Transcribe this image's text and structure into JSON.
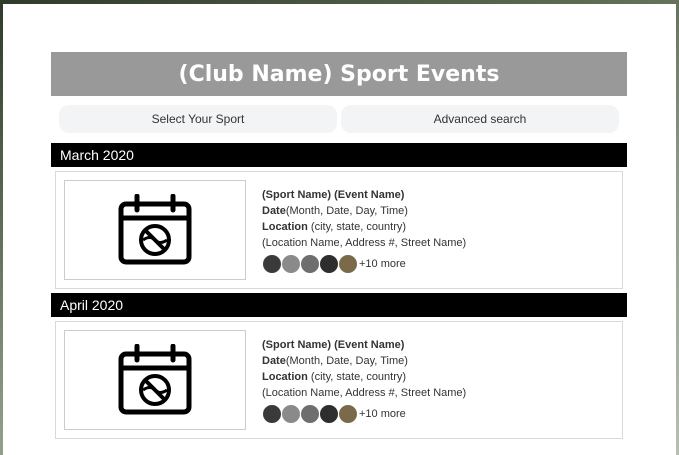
{
  "header": {
    "title": "(Club Name) Sport Events"
  },
  "toolbar": {
    "select_sport_label": "Select Your Sport",
    "advanced_search_label": "Advanced search"
  },
  "sections": [
    {
      "month": "March 2020",
      "event": {
        "title": "(Sport Name) (Event Name)",
        "date_label": "Date",
        "date_value": "(Month, Date, Day, Time)",
        "location_label": "Location",
        "location_value": " (city, state, country)",
        "address": "(Location Name, Address #, Street Name)",
        "more_attendees": "+10 more",
        "icon": "calendar-ball-icon"
      }
    },
    {
      "month": "April 2020",
      "event": {
        "title": "(Sport Name) (Event Name)",
        "date_label": "Date",
        "date_value": "(Month, Date, Day, Time)",
        "location_label": "Location",
        "location_value": " (city, state, country)",
        "address": "(Location Name, Address #, Street Name)",
        "more_attendees": "+10 more",
        "icon": "calendar-ball-icon"
      }
    }
  ],
  "colors": {
    "header_bg": "#999999",
    "month_bar_bg": "#000000",
    "toolbar_btn_bg": "#f3f4f6",
    "avatars": [
      "#3a3a3a",
      "#8a8a8a",
      "#6e6e6e",
      "#2e2e2e",
      "#7a6a4a"
    ]
  }
}
